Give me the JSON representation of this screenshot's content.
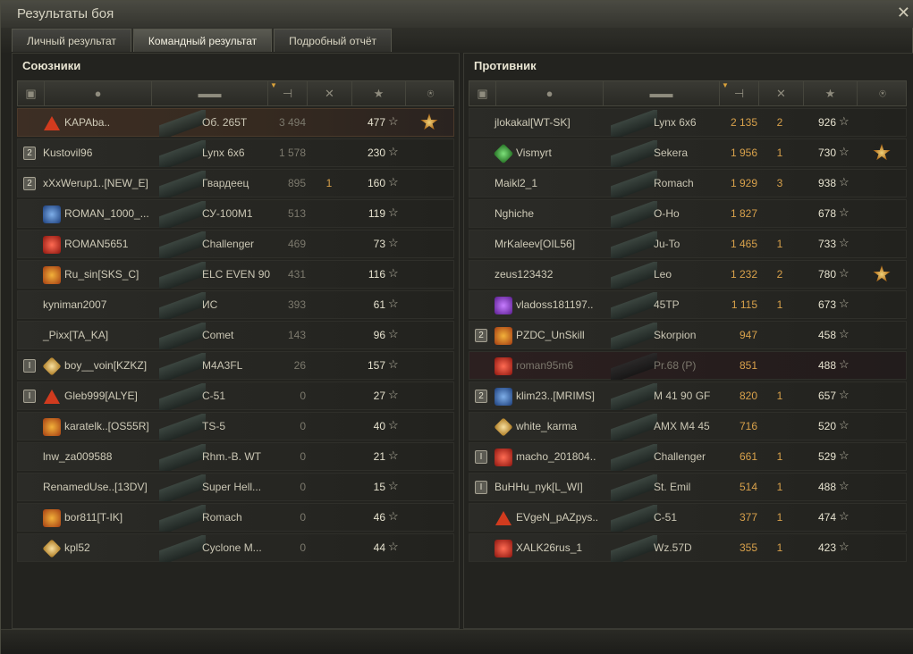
{
  "window": {
    "title": "Результаты боя"
  },
  "tabs": [
    {
      "label": "Личный результат"
    },
    {
      "label": "Командный результат"
    },
    {
      "label": "Подробный отчёт"
    }
  ],
  "allies": {
    "title": "Союзники",
    "rows": [
      {
        "name": "KAPAba..",
        "tank": "Об. 265T",
        "damage": "3 494",
        "frags": "",
        "xp": "477",
        "badge": "warn",
        "platoon": "",
        "medal": true,
        "self": true
      },
      {
        "name": "Kustovil96",
        "tank": "Lynx 6x6",
        "damage": "1 578",
        "frags": "",
        "xp": "230",
        "badge": "",
        "platoon": "2",
        "medal": false
      },
      {
        "name": "xXxWerup1..[NEW_E]",
        "tank": "Гвардеец",
        "damage": "895",
        "frags": "1",
        "xp": "160",
        "badge": "",
        "platoon": "2",
        "medal": false
      },
      {
        "name": "ROMAN_1000_...",
        "tank": "СУ-100М1",
        "damage": "513",
        "frags": "",
        "xp": "119",
        "badge": "blue",
        "platoon": "",
        "medal": false
      },
      {
        "name": "ROMAN5651",
        "tank": "Challenger",
        "damage": "469",
        "frags": "",
        "xp": "73",
        "badge": "red",
        "platoon": "",
        "medal": false
      },
      {
        "name": "Ru_sin[SKS_C]",
        "tank": "ELC EVEN 90",
        "damage": "431",
        "frags": "",
        "xp": "116",
        "badge": "orange",
        "platoon": "",
        "medal": false
      },
      {
        "name": "kyniman2007",
        "tank": "ИС",
        "damage": "393",
        "frags": "",
        "xp": "61",
        "badge": "",
        "platoon": "",
        "medal": false
      },
      {
        "name": "_Pixx[TA_KA]",
        "tank": "Comet",
        "damage": "143",
        "frags": "",
        "xp": "96",
        "badge": "",
        "platoon": "",
        "medal": false
      },
      {
        "name": "boy__voin[KZKZ]",
        "tank": "M4A3FL",
        "damage": "26",
        "frags": "",
        "xp": "157",
        "badge": "gold",
        "platoon": "I",
        "medal": false
      },
      {
        "name": "Gleb999[ALYE]",
        "tank": "C-51",
        "damage": "0",
        "frags": "",
        "xp": "27",
        "badge": "warn",
        "platoon": "I",
        "medal": false
      },
      {
        "name": "karatelk..[OS55R]",
        "tank": "TS-5",
        "damage": "0",
        "frags": "",
        "xp": "40",
        "badge": "orange",
        "platoon": "",
        "medal": false
      },
      {
        "name": "lnw_za009588",
        "tank": "Rhm.-B. WT",
        "damage": "0",
        "frags": "",
        "xp": "21",
        "badge": "",
        "platoon": "",
        "medal": false
      },
      {
        "name": "RenamedUse..[13DV]",
        "tank": "Super Hell...",
        "damage": "0",
        "frags": "",
        "xp": "15",
        "badge": "",
        "platoon": "",
        "medal": false
      },
      {
        "name": "bor811[T-IK]",
        "tank": "Romach",
        "damage": "0",
        "frags": "",
        "xp": "46",
        "badge": "orange",
        "platoon": "",
        "medal": false
      },
      {
        "name": "kpl52",
        "tank": "Cyclone M...",
        "damage": "0",
        "frags": "",
        "xp": "44",
        "badge": "gold",
        "platoon": "",
        "medal": false
      }
    ]
  },
  "enemies": {
    "title": "Противник",
    "rows": [
      {
        "name": "jlokakal[WT-SK]",
        "tank": "Lynx 6x6",
        "damage": "2 135",
        "frags": "2",
        "xp": "926",
        "badge": "",
        "platoon": "",
        "medal": false
      },
      {
        "name": "Vismyrt",
        "tank": "Sekera",
        "damage": "1 956",
        "frags": "1",
        "xp": "730",
        "badge": "green",
        "platoon": "",
        "medal": true
      },
      {
        "name": "Maikl2_1",
        "tank": "Romach",
        "damage": "1 929",
        "frags": "3",
        "xp": "938",
        "badge": "",
        "platoon": "",
        "medal": false
      },
      {
        "name": "Nghiche",
        "tank": "O-Ho",
        "damage": "1 827",
        "frags": "",
        "xp": "678",
        "badge": "",
        "platoon": "",
        "medal": false
      },
      {
        "name": "MrKaleev[OIL56]",
        "tank": "Ju-To",
        "damage": "1 465",
        "frags": "1",
        "xp": "733",
        "badge": "",
        "platoon": "",
        "medal": false
      },
      {
        "name": "zeus123432",
        "tank": "Leo",
        "damage": "1 232",
        "frags": "2",
        "xp": "780",
        "badge": "",
        "platoon": "",
        "medal": true
      },
      {
        "name": "vladoss181197..",
        "tank": "45TP",
        "damage": "1 115",
        "frags": "1",
        "xp": "673",
        "badge": "purple",
        "platoon": "",
        "medal": false
      },
      {
        "name": "PZDC_UnSkill",
        "tank": "Skorpion",
        "damage": "947",
        "frags": "",
        "xp": "458",
        "badge": "orange",
        "platoon": "2",
        "medal": false
      },
      {
        "name": "roman95m6",
        "tank": "Pr.68 (P)",
        "damage": "851",
        "frags": "",
        "xp": "488",
        "badge": "red",
        "platoon": "",
        "medal": false,
        "dead": true
      },
      {
        "name": "klim23..[MRIMS]",
        "tank": "M 41 90 GF",
        "damage": "820",
        "frags": "1",
        "xp": "657",
        "badge": "blue",
        "platoon": "2",
        "medal": false
      },
      {
        "name": "white_karma",
        "tank": "AMX M4 45",
        "damage": "716",
        "frags": "",
        "xp": "520",
        "badge": "gold",
        "platoon": "",
        "medal": false
      },
      {
        "name": "macho_201804..",
        "tank": "Challenger",
        "damage": "661",
        "frags": "1",
        "xp": "529",
        "badge": "red",
        "platoon": "I",
        "medal": false
      },
      {
        "name": "BuHHu_nyk[L_WI]",
        "tank": "St. Emil",
        "damage": "514",
        "frags": "1",
        "xp": "488",
        "badge": "",
        "platoon": "I",
        "medal": false
      },
      {
        "name": "EVgeN_pAZpys..",
        "tank": "C-51",
        "damage": "377",
        "frags": "1",
        "xp": "474",
        "badge": "warn",
        "platoon": "",
        "medal": false
      },
      {
        "name": "XALK26rus_1",
        "tank": "Wz.57D",
        "damage": "355",
        "frags": "1",
        "xp": "423",
        "badge": "red",
        "platoon": "",
        "medal": false
      }
    ]
  },
  "colors": {
    "accent": "#d8a14b",
    "self_row": "#3d2e24",
    "background": "#23231f"
  }
}
